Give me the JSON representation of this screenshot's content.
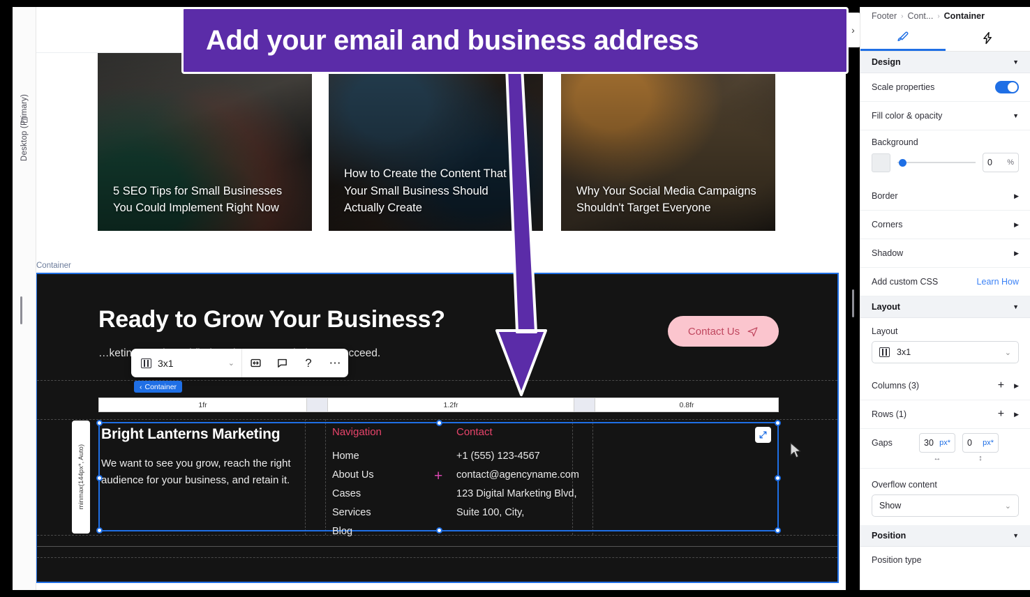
{
  "callout": {
    "text": "Add your email and business address",
    "bg": "#5b2ca8"
  },
  "left_rail": {
    "device_label": "Desktop (Primary)",
    "device_icon": "monitor-icon"
  },
  "canvas": {
    "container_tag": "Container",
    "chevron_icon": "chevron-right-icon",
    "cards": [
      {
        "title": "5 SEO Tips for Small Businesses You Could Implement Right Now"
      },
      {
        "title": "How to Create the Content That Your Small Business Should Actually Create"
      },
      {
        "title": "Why Your Social Media Campaigns Shouldn't Target Everyone"
      }
    ],
    "footer": {
      "hero_title": "Ready to Grow Your Business?",
      "hero_sub": "…keting needs and find out how we can help you succeed.",
      "cta_label": "Contact Us",
      "cta_icon": "send-icon",
      "cta_bg": "#fbc5ce",
      "cta_color": "#c0475f",
      "columns_ruler": [
        "1fr",
        "1.2fr",
        "0.8fr"
      ],
      "row_tag": "minmax(144px*, Auto)",
      "brand": "Bright Lanterns Marketing",
      "brand_sub": "We want to see you grow, reach the right audience for your business, and retain it.",
      "nav_heading": "Navigation",
      "nav_items": [
        "Home",
        "About Us",
        "Cases",
        "Services",
        "Blog"
      ],
      "contact_heading": "Contact",
      "contact_items": [
        "+1 (555) 123-4567",
        "contact@agencyname.com",
        "123 Digital Marketing Blvd,",
        "Suite 100, City,"
      ],
      "heading_color": "#e8446b",
      "selection_color": "#1f6fe5",
      "expand_icon": "expand-diagonal-icon",
      "plus_icon": "plus-marker-icon"
    },
    "toolbar": {
      "layout_value": "3x1",
      "layout_icon": "grid-columns-icon",
      "resize_icon": "resize-horizontal-icon",
      "comment_icon": "comment-icon",
      "help_icon": "question-mark-icon",
      "more_icon": "ellipsis-icon",
      "chevron_icon": "chevron-down-icon"
    },
    "container_badge": {
      "label": "Container",
      "icon": "chevron-left-icon"
    }
  },
  "inspector": {
    "breadcrumb": {
      "root": "Footer",
      "middle": "Cont...",
      "current": "Container",
      "sep": "›"
    },
    "tabs": [
      {
        "name": "design-tab",
        "icon": "brush-icon",
        "active": true
      },
      {
        "name": "interactions-tab",
        "icon": "lightning-icon",
        "active": false
      }
    ],
    "design": {
      "title": "Design",
      "caret": "▼",
      "scale_properties": {
        "label": "Scale properties",
        "enabled": true
      },
      "fill": {
        "label": "Fill color & opacity",
        "caret": "▼",
        "background_label": "Background",
        "opacity_value": "0",
        "opacity_unit": "%"
      },
      "border": {
        "label": "Border",
        "caret": "▶"
      },
      "corners": {
        "label": "Corners",
        "caret": "▶"
      },
      "shadow": {
        "label": "Shadow",
        "caret": "▶"
      },
      "custom_css": {
        "label": "Add custom CSS",
        "link": "Learn How"
      }
    },
    "layout": {
      "title": "Layout",
      "caret": "▼",
      "layout_label": "Layout",
      "layout_value": "3x1",
      "columns_label": "Columns (3)",
      "rows_label": "Rows (1)",
      "gaps_label": "Gaps",
      "gap_column": "30",
      "gap_row": "0",
      "gap_unit": "px*",
      "h_axis_icon": "arrows-horizontal-icon",
      "v_axis_icon": "arrows-vertical-icon",
      "overflow_label": "Overflow content",
      "overflow_value": "Show"
    },
    "position": {
      "title": "Position",
      "caret": "▼",
      "type_label": "Position type"
    }
  }
}
